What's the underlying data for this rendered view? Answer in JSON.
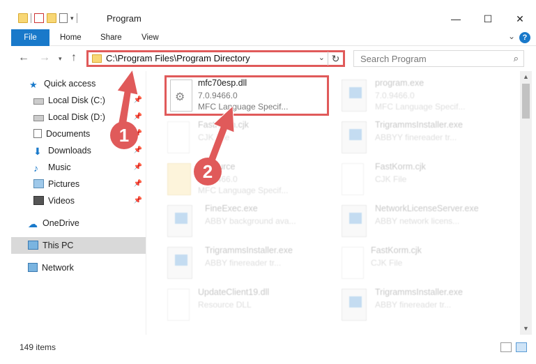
{
  "window": {
    "title": "Program",
    "minimize_glyph": "—",
    "maximize_glyph": "☐",
    "close_glyph": "✕"
  },
  "ribbon": {
    "tabs": [
      "File",
      "Home",
      "Share",
      "View"
    ],
    "help_glyph": "?"
  },
  "navigation": {
    "address": "C:\\Program Files\\Program Directory",
    "search_placeholder": "Search Program"
  },
  "sidebar": {
    "items": [
      {
        "label": "Quick access",
        "icon": "star-icon",
        "pinned": false
      },
      {
        "label": "Local Disk (C:)",
        "icon": "drive-icon",
        "pinned": true
      },
      {
        "label": "Local Disk (D:)",
        "icon": "drive-icon",
        "pinned": true
      },
      {
        "label": "Documents",
        "icon": "documents-icon",
        "pinned": true
      },
      {
        "label": "Downloads",
        "icon": "download-icon",
        "pinned": true
      },
      {
        "label": "Music",
        "icon": "music-icon",
        "pinned": true
      },
      {
        "label": "Pictures",
        "icon": "pictures-icon",
        "pinned": true
      },
      {
        "label": "Videos",
        "icon": "videos-icon",
        "pinned": true
      },
      {
        "label": "OneDrive",
        "icon": "onedrive-icon",
        "pinned": false
      },
      {
        "label": "This PC",
        "icon": "computer-icon",
        "pinned": false,
        "selected": true
      },
      {
        "label": "Network",
        "icon": "network-icon",
        "pinned": false
      }
    ]
  },
  "files": [
    {
      "name": "mfc70esp.dll",
      "line2": "7.0.9466.0",
      "line3": "MFC Language Specif...",
      "icon": "gear-file-icon",
      "highlighted": true
    },
    {
      "name": "program.exe",
      "line2": "7.0.9466.0",
      "line3": "MFC Language Specif...",
      "icon": "app-icon"
    },
    {
      "name": "FastKorm.cjk",
      "line2": "CJK File",
      "icon": "document-icon"
    },
    {
      "name": "TrigrammsInstaller.exe",
      "line2": "ABBYY finereader tr...",
      "icon": "app-icon"
    },
    {
      "name": "Resource",
      "line2": "7.0.9466.0",
      "line3": "MFC Language Specif...",
      "icon": "folder-icon"
    },
    {
      "name": "FastKorm.cjk",
      "line2": "CJK File",
      "icon": "document-icon"
    },
    {
      "name": "FineExec.exe",
      "line2": "ABBY background ava...",
      "icon": "app-icon"
    },
    {
      "name": "NetworkLicenseServer.exe",
      "line2": "ABBY network licens...",
      "icon": "app-icon"
    },
    {
      "name": "TrigrammsInstaller.exe",
      "line2": "ABBY finereader tr...",
      "icon": "app-icon"
    },
    {
      "name": "FastKorm.cjk",
      "line2": "CJK File",
      "icon": "document-icon"
    },
    {
      "name": "UpdateClient19.dll",
      "line2": "Resource DLL",
      "icon": "gear-file-icon"
    },
    {
      "name": "TrigrammsInstaller.exe",
      "line2": "ABBY finereader tr...",
      "icon": "app-icon"
    }
  ],
  "status": {
    "item_count": "149 items"
  },
  "annotations": {
    "badge1": "1",
    "badge2": "2",
    "color": "#e05a5a"
  }
}
